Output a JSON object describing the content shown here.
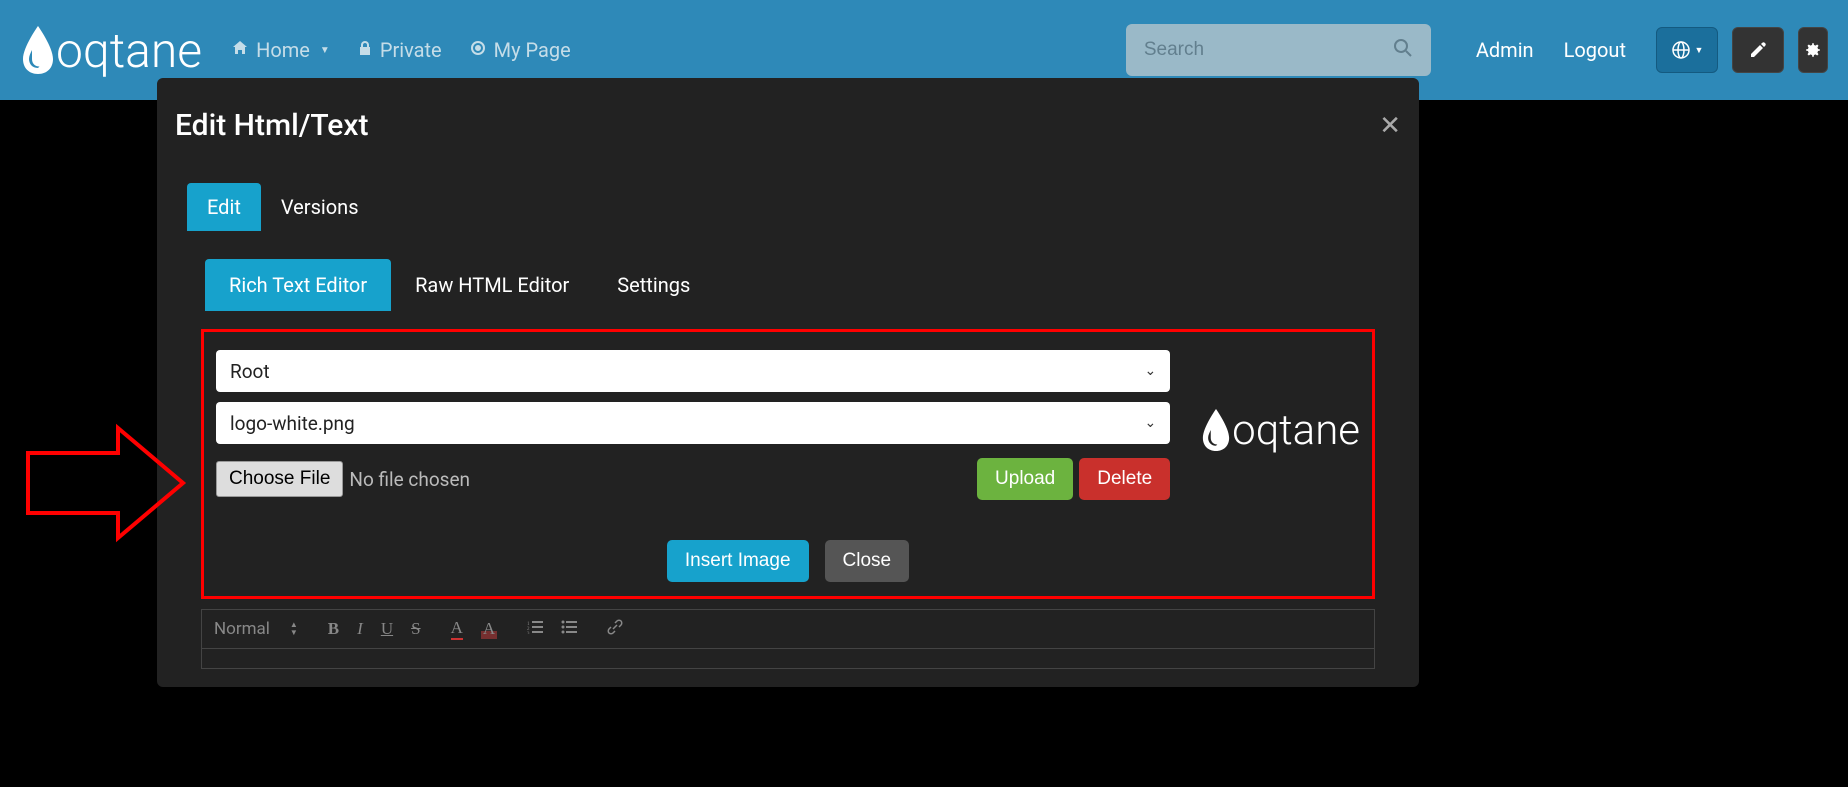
{
  "nav": {
    "brand": "oqtane",
    "items": [
      {
        "label": "Home",
        "icon": "home",
        "dropdown": true
      },
      {
        "label": "Private",
        "icon": "lock",
        "dropdown": false
      },
      {
        "label": "My Page",
        "icon": "target",
        "dropdown": false
      }
    ],
    "search_placeholder": "Search",
    "admin_link": "Admin",
    "logout_link": "Logout"
  },
  "modal": {
    "title": "Edit Html/Text",
    "tabs_outer": [
      {
        "label": "Edit",
        "active": true
      },
      {
        "label": "Versions",
        "active": false
      }
    ],
    "tabs_inner": [
      {
        "label": "Rich Text Editor",
        "active": true
      },
      {
        "label": "Raw HTML Editor",
        "active": false
      },
      {
        "label": "Settings",
        "active": false
      }
    ],
    "folder_select": "Root",
    "file_select": "logo-white.png",
    "choose_file_label": "Choose File",
    "no_file_text": "No file chosen",
    "upload_label": "Upload",
    "delete_label": "Delete",
    "insert_image_label": "Insert Image",
    "close_label": "Close",
    "preview_text": "oqtane"
  },
  "toolbar": {
    "format_label": "Normal"
  }
}
